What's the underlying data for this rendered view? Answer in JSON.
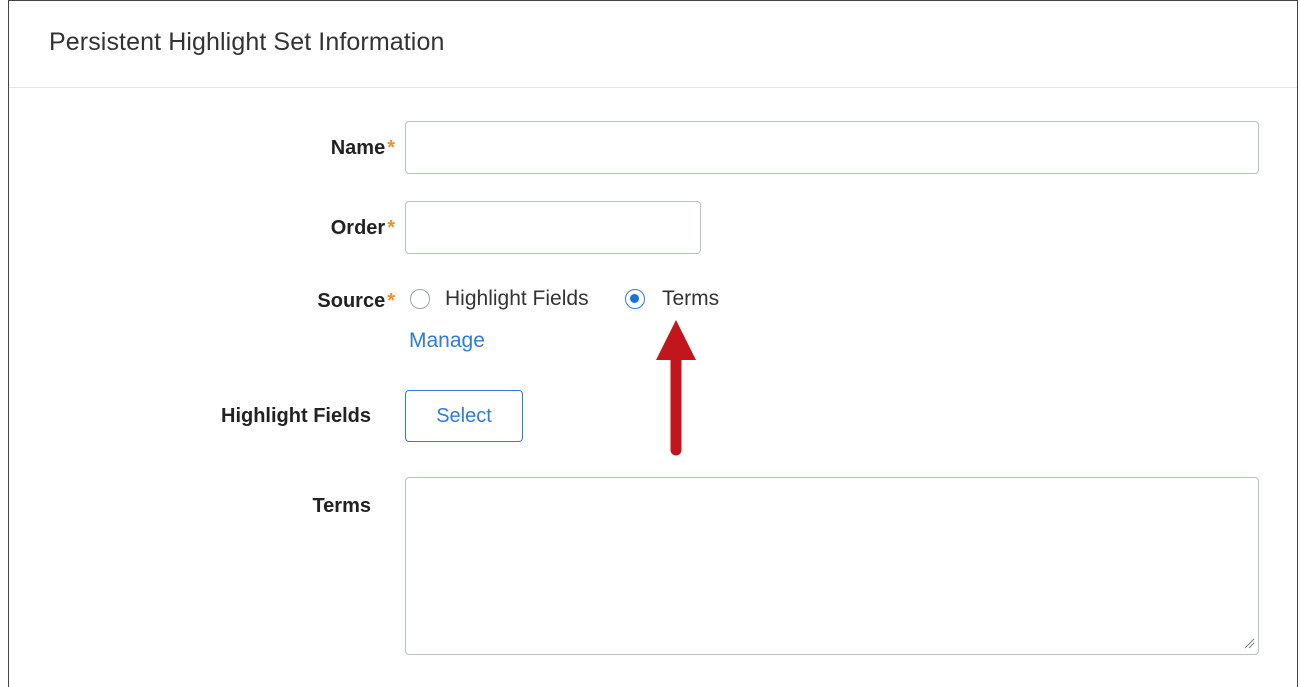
{
  "panel": {
    "title": "Persistent Highlight Set Information"
  },
  "form": {
    "name": {
      "label": "Name",
      "required_mark": "*",
      "value": ""
    },
    "order": {
      "label": "Order",
      "required_mark": "*",
      "value": ""
    },
    "source": {
      "label": "Source",
      "required_mark": "*",
      "options": [
        {
          "label": "Highlight Fields",
          "checked": false
        },
        {
          "label": "Terms",
          "checked": true
        }
      ],
      "manage_link": "Manage"
    },
    "highlight_fields": {
      "label": "Highlight Fields",
      "button_label": "Select"
    },
    "terms": {
      "label": "Terms",
      "value": ""
    }
  },
  "colors": {
    "accent": "#2e7bd8",
    "required": "#f0902a",
    "annotation_arrow": "#c0161c"
  }
}
